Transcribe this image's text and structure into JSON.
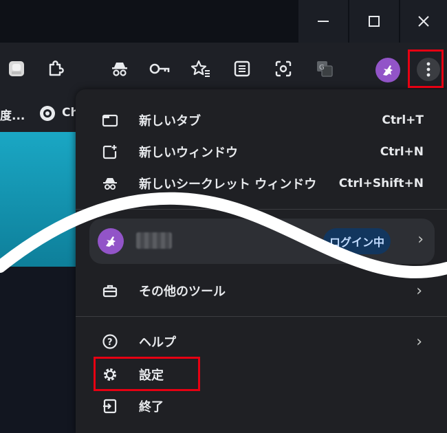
{
  "window_controls": {
    "minimize_icon": "minimize-icon",
    "maximize_icon": "maximize-icon",
    "close_icon": "close-icon"
  },
  "toolbar": {
    "icons": [
      "extension-app-icon",
      "puzzle-extension-icon",
      "incognito-icon",
      "key-icon",
      "star-list-icon",
      "reading-list-icon",
      "screenshot-icon",
      "translate-icon"
    ],
    "menu_button_icon": "three-dot-menu-icon"
  },
  "bookmarks": {
    "item1": "度...",
    "item2": "Ch"
  },
  "menu": {
    "new_tab": {
      "label": "新しいタブ",
      "shortcut": "Ctrl+T"
    },
    "new_window": {
      "label": "新しいウィンドウ",
      "shortcut": "Ctrl+N"
    },
    "incognito": {
      "label": "新しいシークレット ウィンドウ",
      "shortcut": "Ctrl+Shift+N"
    },
    "profile": {
      "badge": "ログイン中"
    },
    "more_tools": {
      "label": "その他のツール"
    },
    "help": {
      "label": "ヘルプ"
    },
    "settings": {
      "label": "設定"
    },
    "exit": {
      "label": "終了"
    }
  },
  "colors": {
    "highlight": "#e60012",
    "menu_bg": "#1f2024",
    "badge_bg": "#12365e",
    "avatar": "#9254c8"
  }
}
